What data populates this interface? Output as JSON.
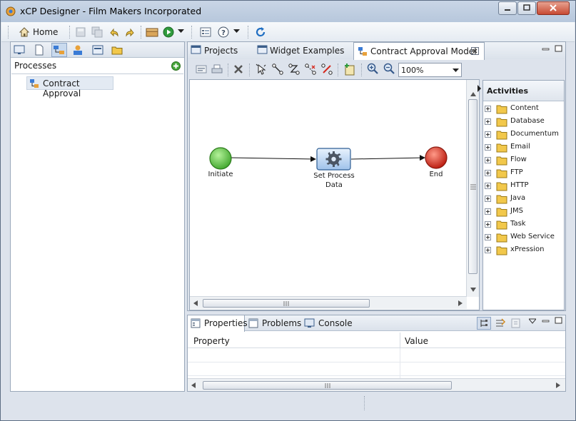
{
  "window": {
    "title": "xCP Designer - Film Makers Incorporated"
  },
  "toolbar": {
    "home_label": "Home"
  },
  "processes_panel": {
    "title": "Processes",
    "items": [
      {
        "label": "Contract Approval"
      }
    ]
  },
  "editor": {
    "tabs": [
      {
        "label": "Projects"
      },
      {
        "label": "Widget Examples"
      },
      {
        "label": "Contract Approval Model"
      }
    ],
    "zoom": "100%",
    "nodes": [
      {
        "label": "Initiate"
      },
      {
        "label": "Set Process Data"
      },
      {
        "label": "End"
      }
    ]
  },
  "activities": {
    "title": "Activities",
    "items": [
      "Content",
      "Database",
      "Documentum",
      "Email",
      "Flow",
      "FTP",
      "HTTP",
      "Java",
      "JMS",
      "Task",
      "Web Service",
      "xPression"
    ]
  },
  "bottom_panel": {
    "tabs": [
      {
        "label": "Properties"
      },
      {
        "label": "Problems"
      },
      {
        "label": "Console"
      }
    ],
    "columns": [
      "Property",
      "Value"
    ]
  },
  "colors": {
    "start_node": "#5cc23a",
    "end_node": "#d8261b",
    "folder": "#f2c84b"
  }
}
